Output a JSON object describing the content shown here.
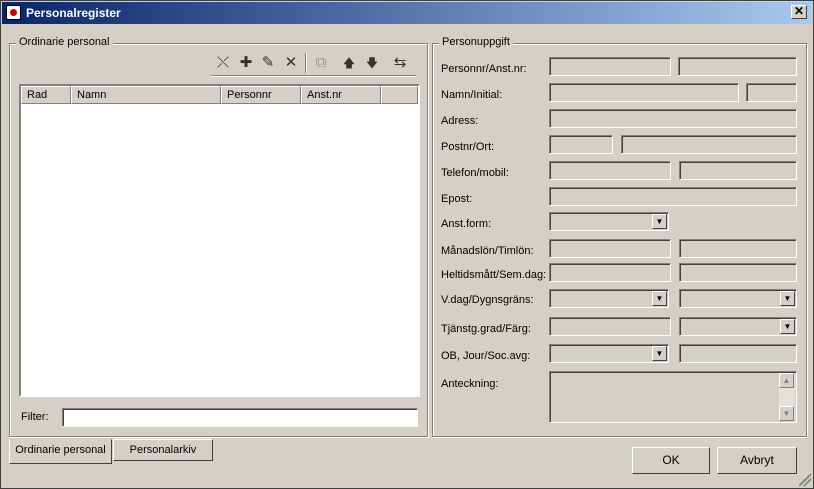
{
  "window": {
    "title": "Personalregister",
    "close": "✕"
  },
  "staff_group": {
    "legend": "Ordinarie personal",
    "toolbar": {
      "clear_icon": "⤬",
      "add_icon": "✚",
      "edit_icon": "✎",
      "delete_icon": "✕",
      "copy_icon": "⧉",
      "up_icon": "🡅",
      "down_icon": "🡇",
      "swap_icon": "⇆"
    },
    "columns": [
      "Rad",
      "Namn",
      "Personnr",
      "Anst.nr"
    ],
    "rows": [],
    "filter_label": "Filter:",
    "filter_value": ""
  },
  "details_group": {
    "legend": "Personuppgift",
    "labels": {
      "personnr": "Personnr/Anst.nr:",
      "namn": "Namn/Initial:",
      "adress": "Adress:",
      "postnr": "Postnr/Ort:",
      "telefon": "Telefon/mobil:",
      "epost": "Epost:",
      "anstform": "Anst.form:",
      "lon": "Månadslön/Timlön:",
      "heltid": "Heltidsmått/Sem.dag:",
      "vdag": "V.dag/Dygnsgräns:",
      "tjanst": "Tjänstg.grad/Färg:",
      "ob": "OB, Jour/Soc.avg:",
      "anteckning": "Anteckning:"
    },
    "combo_arrow": "▼",
    "scroll_up": "▲",
    "scroll_down": "▼"
  },
  "tabs": [
    "Ordinarie personal",
    "Personalarkiv"
  ],
  "buttons": {
    "ok": "OK",
    "cancel": "Avbryt"
  }
}
